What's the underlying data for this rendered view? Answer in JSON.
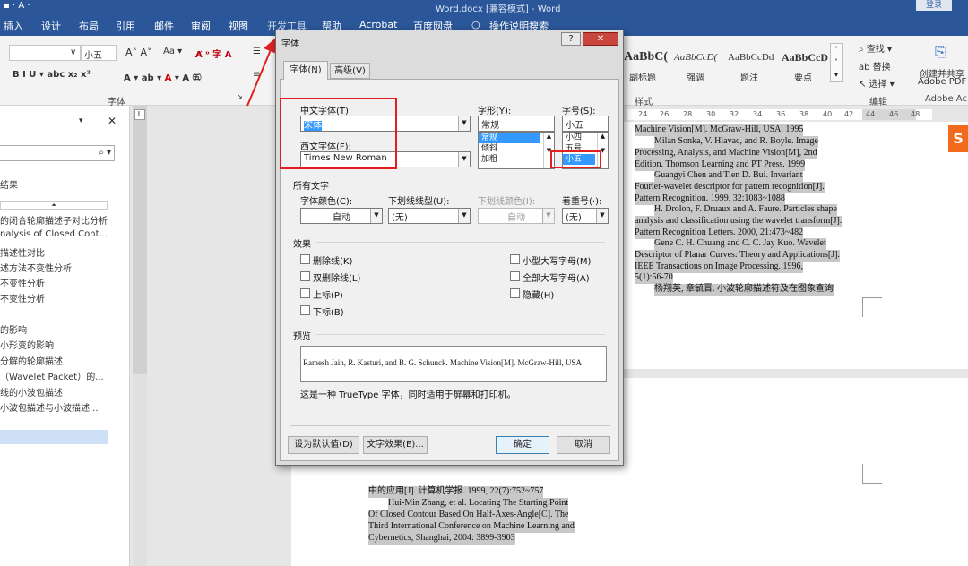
{
  "title": {
    "center": "Word.docx [兼容模式] - Word",
    "login": "登录"
  },
  "tabs": [
    "插入",
    "设计",
    "布局",
    "引用",
    "邮件",
    "审阅",
    "视图",
    "开发工具",
    "帮助",
    "Acrobat",
    "百度网盘",
    "操作说明搜索"
  ],
  "ribbon": {
    "font_size": "小五",
    "styles": [
      "AaBbC(",
      "AaBbCcD(",
      "AaBbCcDd",
      "AaBbCcD"
    ],
    "style_names": [
      "副标题",
      "强调",
      "题注",
      "要点"
    ],
    "find": "查找",
    "replace": "替换",
    "select": "选择",
    "edit_label": "编辑",
    "create_share": "创建并共享",
    "adobe_pdf": "Adobe PDF",
    "adobe_ac": "Adobe Ac",
    "font_label": "字体",
    "style_label": "样式"
  },
  "nav": {
    "items": [
      "结果",
      "的闭合轮廓描述子对比分析",
      "nalysis of Closed Cont...",
      "描述性对比",
      "述方法不变性分析",
      "不变性分析",
      "不变性分析",
      "的影响",
      "小形变的影响",
      "分解的轮廓描述",
      "（Wavelet Packet）的...",
      "线的小波包描述",
      "小波包描述与小波描述..."
    ]
  },
  "ruler": {
    "labels": [
      "24",
      "26",
      "28",
      "30",
      "32",
      "34",
      "36",
      "38",
      "40",
      "42",
      "44",
      "46",
      "48"
    ]
  },
  "doc": {
    "refs_top": [
      "Machine Vision[M]. McGraw-Hill, USA. 1995",
      "Milan Sonka, V. Hlavac, and R. Boyle. Image",
      "Processing, Analysis, and Machine Vision[M], 2nd",
      "Edition. Thomson Learning and PT Press. 1999",
      "Guangyi Chen and Tien D. Bui. Invariant",
      "Fourier-wavelet descriptor for pattern recognition[J].",
      "Pattern Recognition. 1999, 32:1083~1088",
      "H. Drolon, F. Druaux and A. Faure. Particles shape",
      "analysis and classification using the wavelet transform[J].",
      "Pattern Recognition Letters. 2000, 21:473~482",
      "Gene C. H. Chuang and C. C. Jay Kuo. Wavelet",
      "Descriptor of Planar Curves: Theory and Applications[J].",
      "IEEE Transactions on Image Processing. 1996,",
      "5(1):56-70",
      "杨翔英, 章毓晋. 小波轮廓描述符及在图象查询"
    ],
    "refs_bottom": [
      "中的应用[J]. 计算机学报. 1999, 22(7):752~757",
      "Hui-Min Zhang, et al. Locating The Starting Point",
      "Of Closed Contour Based On Half-Axes-Angle[C]. The",
      "Third International Conference on Machine Learning and",
      "Cybernetics, Shanghai, 2004: 3899-3903"
    ]
  },
  "dialog": {
    "title": "字体",
    "help": "?",
    "close": "✕",
    "tab_font": "字体(N)",
    "tab_adv": "高级(V)",
    "cn_font_label": "中文字体(T):",
    "cn_font_value": "宋体",
    "west_font_label": "西文字体(F):",
    "west_font_value": "Times New Roman",
    "style_label": "字形(Y):",
    "style_value": "常规",
    "style_options": [
      "常规",
      "倾斜",
      "加粗"
    ],
    "size_label": "字号(S):",
    "size_value": "小五",
    "size_options": [
      "小四",
      "五号",
      "小五"
    ],
    "all_text": "所有文字",
    "color_label": "字体颜色(C):",
    "color_value": "自动",
    "underline_label": "下划线线型(U):",
    "underline_value": "(无)",
    "ucolor_label": "下划线颜色(I):",
    "ucolor_value": "自动",
    "emph_label": "着重号(·):",
    "emph_value": "(无)",
    "effects": "效果",
    "checks_left": [
      "删除线(K)",
      "双删除线(L)",
      "上标(P)",
      "下标(B)"
    ],
    "checks_right": [
      "小型大写字母(M)",
      "全部大写字母(A)",
      "隐藏(H)"
    ],
    "preview_label": "预览",
    "preview_text": "Ramesh Jain, R. Kasturi, and B. G. Schunck. Machine Vision[M]. McGraw-Hill, USA",
    "truetype_note": "这是一种 TrueType 字体，同时适用于屏幕和打印机。",
    "btn_default": "设为默认值(D)",
    "btn_effects": "文字效果(E)...",
    "btn_ok": "确定",
    "btn_cancel": "取消"
  }
}
